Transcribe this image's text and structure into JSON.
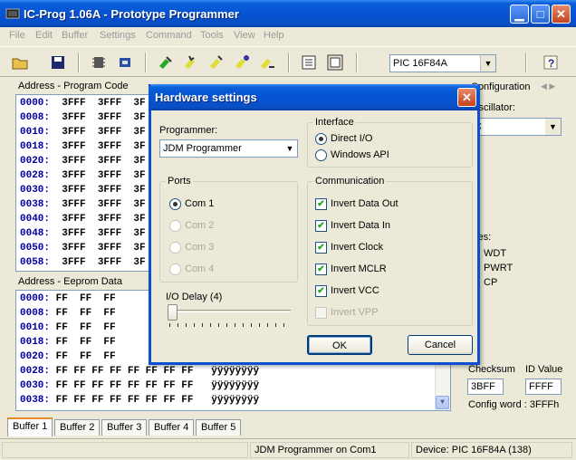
{
  "window": {
    "title": "IC-Prog 1.06A - Prototype Programmer"
  },
  "menu": [
    "File",
    "Edit",
    "Buffer",
    "Settings",
    "Command",
    "Tools",
    "View",
    "Help"
  ],
  "toolbar": {
    "device": "PIC 16F84A"
  },
  "program_panel": {
    "label": "Address - Program Code",
    "rows": [
      {
        "addr": "0000:",
        "data": "3FFF  3FFF  3F"
      },
      {
        "addr": "0008:",
        "data": "3FFF  3FFF  3F"
      },
      {
        "addr": "0010:",
        "data": "3FFF  3FFF  3F"
      },
      {
        "addr": "0018:",
        "data": "3FFF  3FFF  3F"
      },
      {
        "addr": "0020:",
        "data": "3FFF  3FFF  3F"
      },
      {
        "addr": "0028:",
        "data": "3FFF  3FFF  3F"
      },
      {
        "addr": "0030:",
        "data": "3FFF  3FFF  3F"
      },
      {
        "addr": "0038:",
        "data": "3FFF  3FFF  3F"
      },
      {
        "addr": "0040:",
        "data": "3FFF  3FFF  3F"
      },
      {
        "addr": "0048:",
        "data": "3FFF  3FFF  3F"
      },
      {
        "addr": "0050:",
        "data": "3FFF  3FFF  3F"
      },
      {
        "addr": "0058:",
        "data": "3FFF  3FFF  3F"
      }
    ]
  },
  "eeprom_panel": {
    "label": "Address - Eeprom Data",
    "rows": [
      {
        "addr": "0000:",
        "data": "FF  FF  FF"
      },
      {
        "addr": "0008:",
        "data": "FF  FF  FF"
      },
      {
        "addr": "0010:",
        "data": "FF  FF  FF"
      },
      {
        "addr": "0018:",
        "data": "FF  FF  FF"
      },
      {
        "addr": "0020:",
        "data": "FF  FF  FF"
      },
      {
        "addr": "0028:",
        "data": "FF FF FF FF FF FF FF FF   ÿÿÿÿÿÿÿÿ"
      },
      {
        "addr": "0030:",
        "data": "FF FF FF FF FF FF FF FF   ÿÿÿÿÿÿÿÿ"
      },
      {
        "addr": "0038:",
        "data": "FF FF FF FF FF FF FF FF   ÿÿÿÿÿÿÿÿ"
      }
    ]
  },
  "config_panel": {
    "title": "Configuration",
    "oscillator_label": "Oscillator:",
    "oscillator_value": "C",
    "fuses_label": "ses:",
    "fuses": [
      "WDT",
      "PWRT",
      "CP"
    ],
    "checksum_label": "Checksum",
    "checksum_value": "3BFF",
    "id_label": "ID Value",
    "id_value": "FFFF",
    "config_word": "Config word : 3FFFh"
  },
  "tabs": [
    "Buffer 1",
    "Buffer 2",
    "Buffer 3",
    "Buffer 4",
    "Buffer 5"
  ],
  "status": {
    "programmer": "JDM Programmer on Com1",
    "device": "Device: PIC 16F84A  (138)"
  },
  "dialog": {
    "title": "Hardware settings",
    "programmer_label": "Programmer:",
    "programmer_value": "JDM Programmer",
    "ports_label": "Ports",
    "ports": [
      "Com 1",
      "Com 2",
      "Com 3",
      "Com 4"
    ],
    "io_delay_label": "I/O Delay (4)",
    "io_delay_value": 4,
    "interface_label": "Interface",
    "interface_options": [
      "Direct I/O",
      "Windows API"
    ],
    "communication_label": "Communication",
    "communication": [
      {
        "label": "Invert Data Out",
        "checked": true,
        "enabled": true
      },
      {
        "label": "Invert Data In",
        "checked": true,
        "enabled": true
      },
      {
        "label": "Invert Clock",
        "checked": true,
        "enabled": true
      },
      {
        "label": "Invert MCLR",
        "checked": true,
        "enabled": true
      },
      {
        "label": "Invert VCC",
        "checked": true,
        "enabled": true
      },
      {
        "label": "Invert VPP",
        "checked": false,
        "enabled": false
      }
    ],
    "ok_label": "OK",
    "cancel_label": "Cancel"
  }
}
